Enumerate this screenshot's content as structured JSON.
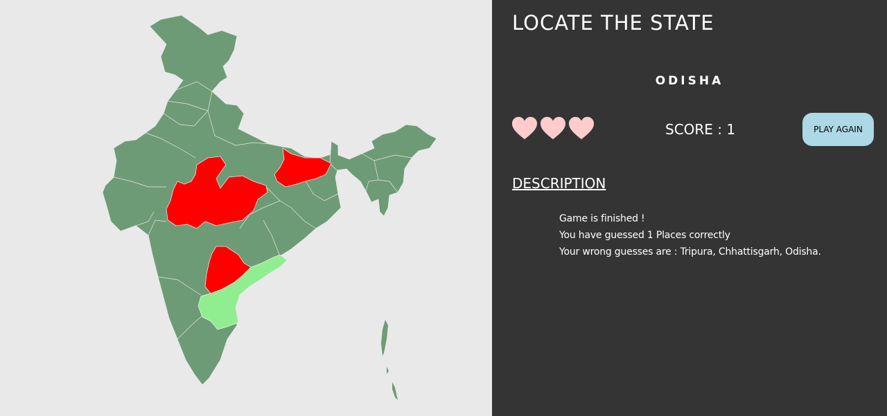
{
  "game": {
    "title": "LOCATE THE STATE",
    "target_state": "ODISHA",
    "lives_remaining": 3,
    "score_text": "SCORE : 1",
    "play_again_label": "PLAY AGAIN"
  },
  "description": {
    "heading": "DESCRIPTION",
    "lines": [
      "Game is finished !",
      "You have guessed 1 Places correctly",
      "Your wrong guesses are : Tripura, Chhattisgarh, Odisha."
    ]
  },
  "map": {
    "colors": {
      "default": "#6d9b75",
      "wrong": "#ff0000",
      "correct": "#90ee90",
      "border": "#e9e9e9",
      "heart": "#ffcccc"
    },
    "highlighted_regions": [
      {
        "region": "bihar",
        "status": "wrong"
      },
      {
        "region": "madhya-pradesh",
        "status": "wrong"
      },
      {
        "region": "telangana",
        "status": "wrong"
      },
      {
        "region": "andhra-pradesh",
        "status": "correct"
      }
    ]
  }
}
